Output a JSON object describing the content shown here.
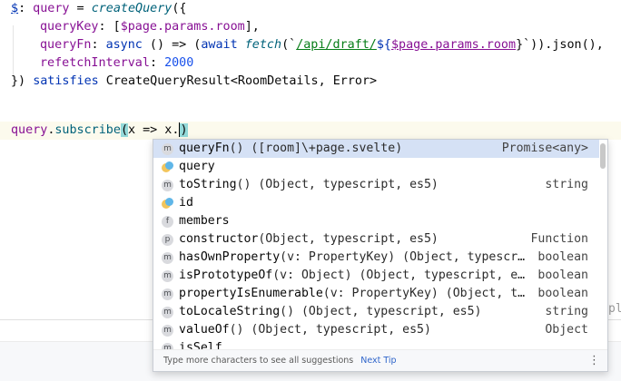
{
  "code": {
    "l1_dollar": "$",
    "l1_colon": ":",
    "l1_var": " query",
    "l1_eq": " = ",
    "l1_fn": "createQuery",
    "l1_open": "({",
    "l2_key": "queryKey",
    "l2_colon": ": [",
    "l2_expr": "$page.params.room",
    "l2_end": "],",
    "l3_key": "queryFn",
    "l3_colon": ": ",
    "l3_async": "async",
    "l3_arrow": " () => (",
    "l3_await": "await",
    "l3_space": " ",
    "l3_fetch": "fetch",
    "l3_open": "(`",
    "l3_path": "/api/draft/",
    "l3_dollarbrace": "${",
    "l3_expr": "$page.params.room",
    "l3_close": "}`)).json(),",
    "l4_key": "refetchInterval",
    "l4_colon": ": ",
    "l4_num": "2000",
    "l5_close": "}) ",
    "l5_satisfies": "satisfies",
    "l5_type": " CreateQueryResult<RoomDetails, Error>",
    "l7_var": "query",
    "l7_dot": ".",
    "l7_method": "subscribe",
    "l7_paren": "(",
    "l7_rest": "x => x.",
    "l7_close": ")"
  },
  "completion": {
    "items": [
      {
        "icon": "m",
        "name": "queryFn",
        "sig": "() ([room]\\+page.svelte)",
        "type": "Promise<any>"
      },
      {
        "icon": "property",
        "name": "query",
        "sig": "",
        "type": ""
      },
      {
        "icon": "m",
        "name": "toString",
        "sig": "() (Object, typescript, es5)",
        "type": "string"
      },
      {
        "icon": "property",
        "name": "id",
        "sig": "",
        "type": ""
      },
      {
        "icon": "f",
        "name": "members",
        "sig": "",
        "type": ""
      },
      {
        "icon": "p",
        "name": "constructor",
        "sig": " (Object, typescript, es5)",
        "type": "Function"
      },
      {
        "icon": "m",
        "name": "hasOwnProperty",
        "sig": "(v: PropertyKey) (Object, typescr…",
        "type": "boolean"
      },
      {
        "icon": "m",
        "name": "isPrototypeOf",
        "sig": "(v: Object) (Object, typescript, e…",
        "type": "boolean"
      },
      {
        "icon": "m",
        "name": "propertyIsEnumerable",
        "sig": "(v: PropertyKey) (Object, t…",
        "type": "boolean"
      },
      {
        "icon": "m",
        "name": "toLocaleString",
        "sig": "() (Object, typescript, es5)",
        "type": "string"
      },
      {
        "icon": "m",
        "name": "valueOf",
        "sig": "() (Object, typescript, es5)",
        "type": "Object"
      },
      {
        "icon": "m",
        "name": "isSelf",
        "sig": "",
        "type": ""
      }
    ],
    "footer_hint": "Type more characters to see all suggestions",
    "footer_tip": "Next Tip",
    "more_icon": "kebab-icon"
  },
  "right_fragment": "pl"
}
